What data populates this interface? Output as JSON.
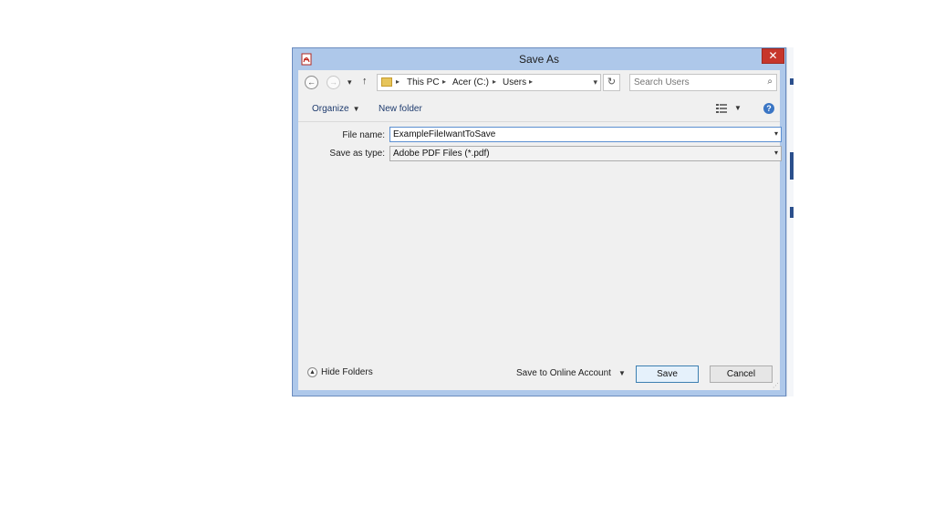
{
  "window": {
    "title": "Save As",
    "close_glyph": "✕",
    "icon": "pdf-icon"
  },
  "nav": {
    "back_glyph": "←",
    "forward_glyph": "→",
    "recent_glyph": "▾",
    "up_glyph": "↑",
    "breadcrumbs": [
      "This PC",
      "Acer (C:)",
      "Users"
    ],
    "crumb_sep": "▸",
    "refresh_glyph": "↻",
    "search_placeholder": "Search Users",
    "search_glyph": "⌕"
  },
  "toolbar": {
    "organize_label": "Organize",
    "new_folder_label": "New folder",
    "help_glyph": "?"
  },
  "fields": {
    "file_name_label": "File name:",
    "file_name_value": "ExampleFileIwantToSave",
    "save_type_label": "Save as type:",
    "save_type_value": "Adobe PDF Files (*.pdf)"
  },
  "footer": {
    "hide_folders_label": "Hide Folders",
    "save_online_label": "Save to Online Account",
    "save_label": "Save",
    "cancel_label": "Cancel"
  },
  "colors": {
    "frame": "#aec8ea",
    "close": "#c7362b",
    "accent": "#3a75c4"
  }
}
